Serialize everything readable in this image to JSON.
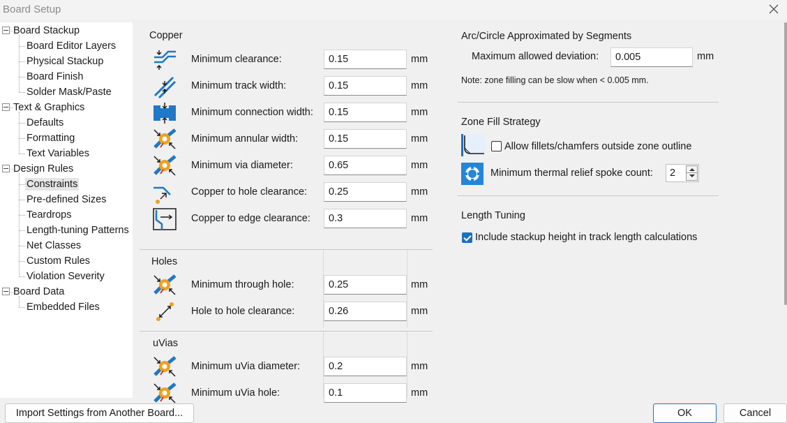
{
  "window": {
    "title": "Board Setup"
  },
  "tree": [
    {
      "label": "Board Stackup",
      "level": 0
    },
    {
      "label": "Board Editor Layers",
      "level": 1
    },
    {
      "label": "Physical Stackup",
      "level": 1
    },
    {
      "label": "Board Finish",
      "level": 1
    },
    {
      "label": "Solder Mask/Paste",
      "level": 1
    },
    {
      "label": "Text & Graphics",
      "level": 0
    },
    {
      "label": "Defaults",
      "level": 1
    },
    {
      "label": "Formatting",
      "level": 1
    },
    {
      "label": "Text Variables",
      "level": 1
    },
    {
      "label": "Design Rules",
      "level": 0
    },
    {
      "label": "Constraints",
      "level": 1,
      "selected": true
    },
    {
      "label": "Pre-defined Sizes",
      "level": 1
    },
    {
      "label": "Teardrops",
      "level": 1
    },
    {
      "label": "Length-tuning Patterns",
      "level": 1
    },
    {
      "label": "Net Classes",
      "level": 1
    },
    {
      "label": "Custom Rules",
      "level": 1
    },
    {
      "label": "Violation Severity",
      "level": 1
    },
    {
      "label": "Board Data",
      "level": 0
    },
    {
      "label": "Embedded Files",
      "level": 1
    }
  ],
  "copper": {
    "title": "Copper",
    "rules": [
      {
        "label": "Minimum clearance:",
        "value": "0.15",
        "unit": "mm",
        "icon": "clearance-icon"
      },
      {
        "label": "Minimum track width:",
        "value": "0.15",
        "unit": "mm",
        "icon": "track-width-icon"
      },
      {
        "label": "Minimum connection width:",
        "value": "0.15",
        "unit": "mm",
        "icon": "connection-width-icon"
      },
      {
        "label": "Minimum annular width:",
        "value": "0.15",
        "unit": "mm",
        "icon": "annular-width-icon"
      },
      {
        "label": "Minimum via diameter:",
        "value": "0.65",
        "unit": "mm",
        "icon": "via-diameter-icon"
      },
      {
        "label": "Copper to hole clearance:",
        "value": "0.25",
        "unit": "mm",
        "icon": "copper-hole-clearance-icon"
      },
      {
        "label": "Copper to edge clearance:",
        "value": "0.3",
        "unit": "mm",
        "icon": "copper-edge-clearance-icon"
      }
    ]
  },
  "holes": {
    "title": "Holes",
    "rules": [
      {
        "label": "Minimum through hole:",
        "value": "0.25",
        "unit": "mm",
        "icon": "through-hole-icon"
      },
      {
        "label": "Hole to hole clearance:",
        "value": "0.26",
        "unit": "mm",
        "icon": "hole-clearance-icon"
      }
    ]
  },
  "uvias": {
    "title": "uVias",
    "rules": [
      {
        "label": "Minimum uVia diameter:",
        "value": "0.2",
        "unit": "mm",
        "icon": "uvia-diameter-icon"
      },
      {
        "label": "Minimum uVia hole:",
        "value": "0.1",
        "unit": "mm",
        "icon": "uvia-hole-icon"
      }
    ]
  },
  "arc": {
    "title": "Arc/Circle Approximated by Segments",
    "max_dev_label": "Maximum allowed deviation:",
    "max_dev_value": "0.005",
    "unit": "mm",
    "note": "Note: zone filling can be slow when < 0.005 mm."
  },
  "zone": {
    "title": "Zone Fill Strategy",
    "fillets_label": "Allow fillets/chamfers outside zone outline",
    "fillets_checked": false,
    "spoke_label": "Minimum thermal relief spoke count:",
    "spoke_value": "2"
  },
  "length": {
    "title": "Length Tuning",
    "stackup_label": "Include stackup height in track length calculations",
    "stackup_checked": true
  },
  "buttons": {
    "import": "Import Settings from Another Board...",
    "ok": "OK",
    "cancel": "Cancel"
  }
}
